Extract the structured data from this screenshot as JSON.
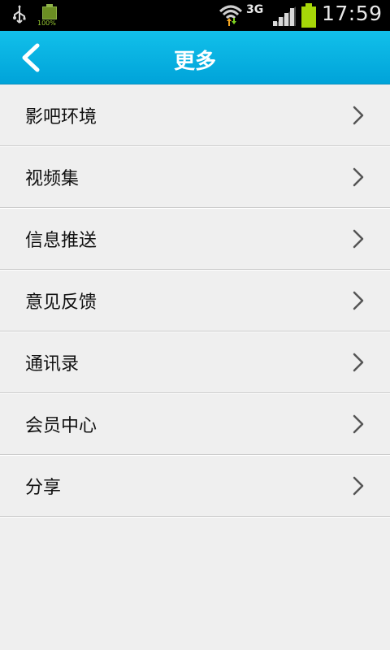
{
  "status_bar": {
    "battery_small_label": "100%",
    "network": "3G",
    "time": "17:59",
    "icons": [
      "usb-icon",
      "battery-icon",
      "wifi-icon",
      "signal-icon",
      "battery-icon"
    ],
    "battery_level": 1.0
  },
  "header": {
    "title": "更多",
    "back_icon": "chevron-left-icon",
    "color": "#00a3d9"
  },
  "menu": {
    "items": [
      {
        "label": "影吧环境"
      },
      {
        "label": "视频集"
      },
      {
        "label": "信息推送"
      },
      {
        "label": "意见反馈"
      },
      {
        "label": "通讯录"
      },
      {
        "label": "会员中心"
      },
      {
        "label": "分享"
      }
    ],
    "chevron_icon": "chevron-right-icon"
  }
}
